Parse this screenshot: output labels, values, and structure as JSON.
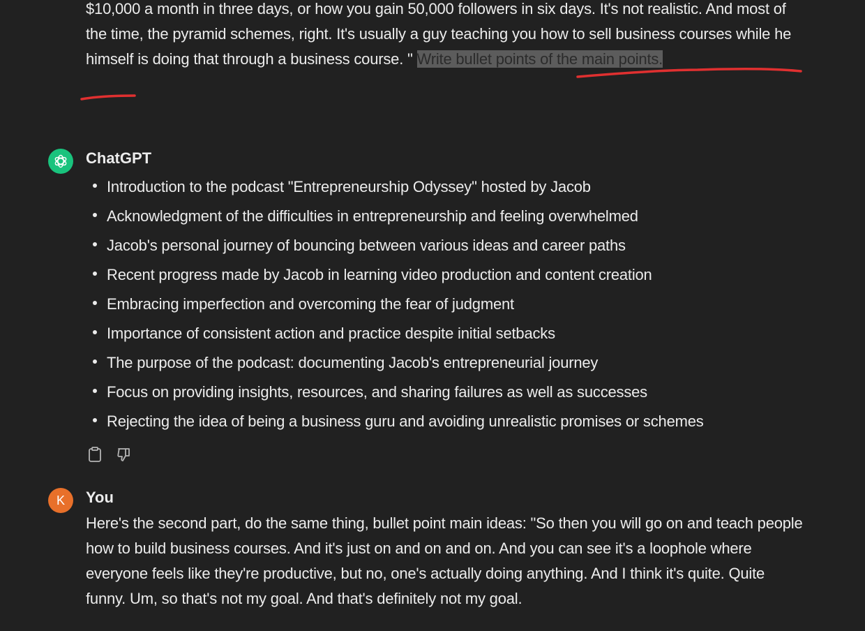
{
  "previous_message": {
    "text_before_highlight": "$10,000 a month in three days, or how you gain 50,000 followers in six days.  It's not realistic. And most of the time, the pyramid schemes, right. It's usually a guy teaching you how to sell business courses while he himself is doing that through a business course. \" ",
    "highlighted_text": "Write bullet points of the main points."
  },
  "assistant": {
    "name": "ChatGPT",
    "avatar_icon": "openai-logo-icon",
    "avatar_color": "#19c37d",
    "bullets": [
      "Introduction to the podcast \"Entrepreneurship Odyssey\" hosted by Jacob",
      "Acknowledgment of the difficulties in entrepreneurship and feeling overwhelmed",
      "Jacob's personal journey of bouncing between various ideas and career paths",
      "Recent progress made by Jacob in learning video production and content creation",
      "Embracing imperfection and overcoming the fear of judgment",
      "Importance of consistent action and practice despite initial setbacks",
      "The purpose of the podcast: documenting Jacob's entrepreneurial journey",
      "Focus on providing insights, resources, and sharing failures as well as successes",
      "Rejecting the idea of being a business guru and avoiding unrealistic promises or schemes"
    ],
    "actions": [
      "copy-icon",
      "thumbs-down-icon"
    ]
  },
  "user": {
    "name": "You",
    "avatar_letter": "K",
    "avatar_color": "#e8702a",
    "message": "Here's the second part, do the same thing, bullet point main ideas: \"So then you will go on and teach people how to build business courses. And it's just on and on and on. And you can see it's a loophole where everyone feels like they're productive, but no, one's actually doing anything. And I think it's quite. Quite funny. Um, so that's not my goal.  And that's definitely not my goal."
  },
  "annotation_color": "#e03030"
}
